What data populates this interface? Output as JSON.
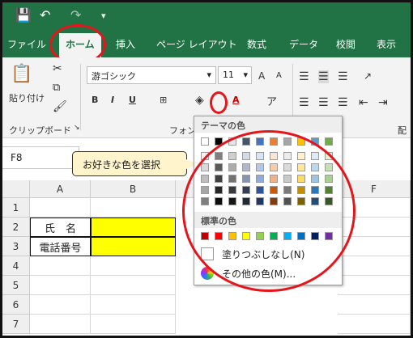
{
  "colors": {
    "excel_green": "#217346",
    "highlight_red": "#e4161b",
    "cell_yellow": "#ffff00",
    "callout_fill": "#fff4cc"
  },
  "quick_access": {
    "save_icon": "save-icon",
    "undo_icon": "undo-icon",
    "redo_icon": "redo-icon",
    "customize_icon": "customize-icon"
  },
  "menu": [
    {
      "label": "ファイル"
    },
    {
      "label": "ホーム",
      "active": true
    },
    {
      "label": "挿入"
    },
    {
      "label": "ページ レイアウト"
    },
    {
      "label": "数式"
    },
    {
      "label": "データ"
    },
    {
      "label": "校閲"
    },
    {
      "label": "表示"
    }
  ],
  "ribbon": {
    "paste": "貼り付け",
    "clipboard": "クリップボード",
    "font_name": "游ゴシック",
    "font_size": "11",
    "grow": "A",
    "shrink": "A",
    "bold": "B",
    "italic": "I",
    "underline": "U",
    "font_group": "フォント",
    "alignment_short": "配"
  },
  "namebox": {
    "value": "F8"
  },
  "callout": {
    "text": "お好きな色を選択"
  },
  "palette": {
    "theme_title": "テーマの色",
    "standard_title": "標準の色",
    "no_fill": "塗りつぶしなし(N)",
    "more_colors": "その他の色(M)...",
    "theme_top": [
      "#ffffff",
      "#000000",
      "#e7e6e6",
      "#44546a",
      "#4472c4",
      "#ed7d31",
      "#a5a5a5",
      "#ffc000",
      "#5b9bd5",
      "#70ad47"
    ],
    "theme_shades": [
      [
        "#f2f2f2",
        "#7f7f7f",
        "#d0cece",
        "#d6dce5",
        "#dae3f3",
        "#fbe5d6",
        "#ededed",
        "#fff2cc",
        "#deebf7",
        "#e2f0d9"
      ],
      [
        "#d9d9d9",
        "#595959",
        "#aeabab",
        "#adb9ca",
        "#b4c7e7",
        "#f8cbad",
        "#dbdbdb",
        "#ffe699",
        "#bdd7ee",
        "#c5e0b4"
      ],
      [
        "#bfbfbf",
        "#404040",
        "#757171",
        "#8497b0",
        "#8faadc",
        "#f4b183",
        "#c9c9c9",
        "#ffd966",
        "#9dc3e6",
        "#a9d18e"
      ],
      [
        "#a6a6a6",
        "#262626",
        "#3a3838",
        "#333f50",
        "#2f5597",
        "#c55a11",
        "#7b7b7b",
        "#bf9000",
        "#2e75b6",
        "#548235"
      ],
      [
        "#7f7f7f",
        "#0d0d0d",
        "#171616",
        "#222a35",
        "#203864",
        "#843c0c",
        "#525252",
        "#7f6000",
        "#1f4e79",
        "#385723"
      ]
    ],
    "standard": [
      "#c00000",
      "#ff0000",
      "#ffc000",
      "#ffff00",
      "#92d050",
      "#00b050",
      "#00b0f0",
      "#0070c0",
      "#002060",
      "#7030a0"
    ]
  },
  "sheet": {
    "columns": [
      "A",
      "B",
      "F"
    ],
    "rows": [
      "1",
      "2",
      "3",
      "4",
      "5",
      "6",
      "7"
    ],
    "cells": {
      "a2": "氏　名",
      "a3": "電話番号"
    }
  }
}
